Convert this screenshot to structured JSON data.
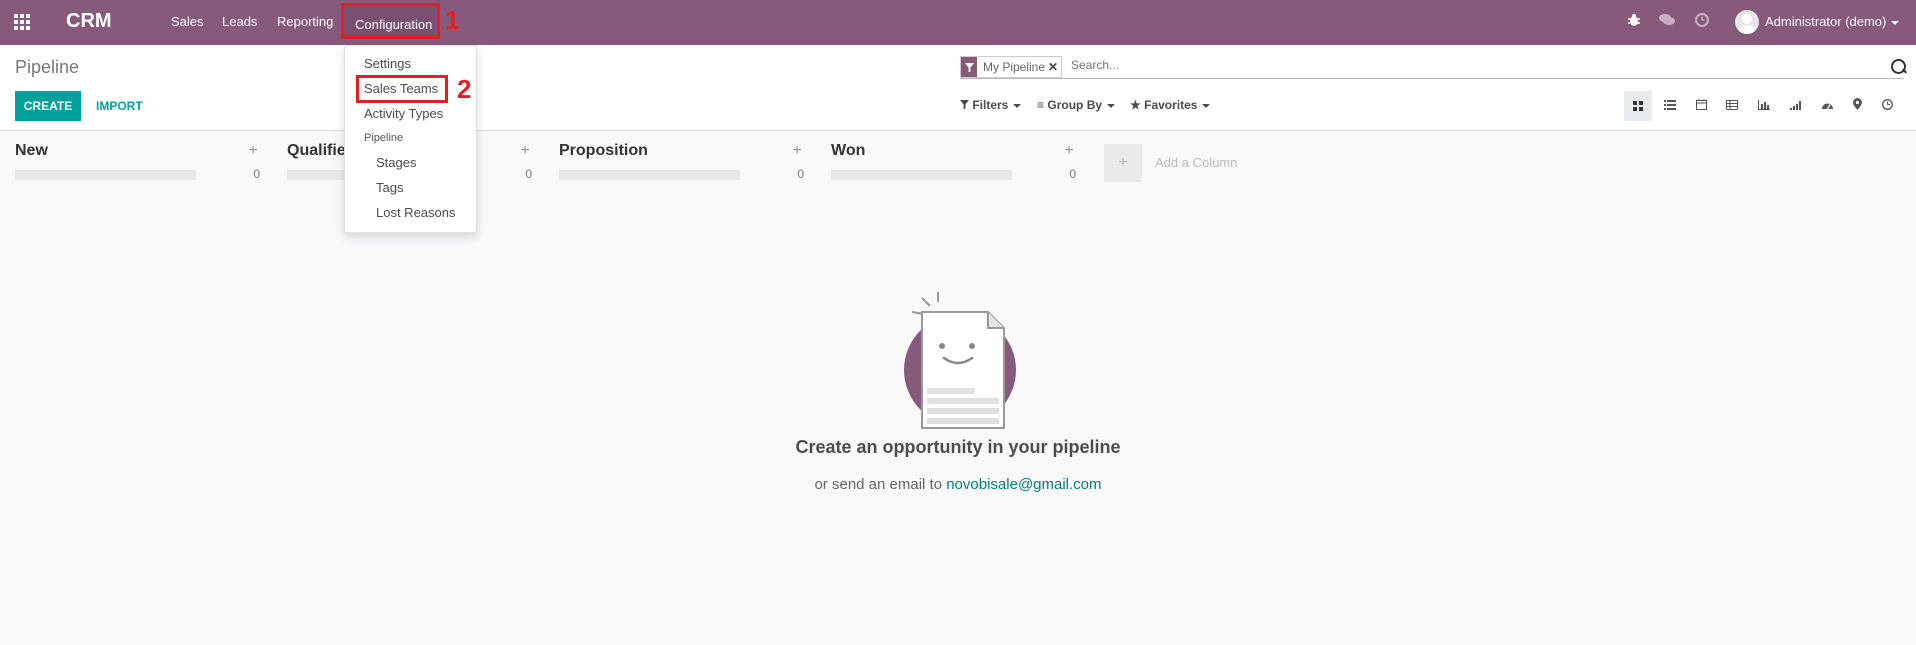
{
  "navbar": {
    "brand": "CRM",
    "menu": [
      "Sales",
      "Leads",
      "Reporting",
      "Configuration"
    ],
    "user": "Administrator (demo)",
    "system_icons": [
      "bug-icon",
      "chat-icon",
      "clock-icon"
    ]
  },
  "annotations": {
    "step1": "1",
    "step2": "2"
  },
  "config_menu": {
    "items": [
      "Settings",
      "Sales Teams",
      "Activity Types"
    ],
    "pipeline_header": "Pipeline",
    "pipeline_items": [
      "Stages",
      "Tags",
      "Lost Reasons"
    ]
  },
  "control_panel": {
    "breadcrumb": "Pipeline",
    "create_label": "CREATE",
    "import_label": "IMPORT",
    "facet": "My Pipeline",
    "search_placeholder": "Search...",
    "filters": "Filters",
    "group_by": "Group By",
    "favorites": "Favorites",
    "views": [
      "kanban",
      "list",
      "calendar",
      "pivot",
      "graph",
      "cohort",
      "dashboard",
      "map",
      "activity"
    ],
    "active_view": "kanban"
  },
  "columns": [
    {
      "title": "New",
      "count": "0"
    },
    {
      "title": "Qualified",
      "count": "0"
    },
    {
      "title": "Proposition",
      "count": "0"
    },
    {
      "title": "Won",
      "count": "0"
    }
  ],
  "add_column": "Add a Column",
  "empty": {
    "title": "Create an opportunity in your pipeline",
    "sub_prefix": "or send an email to",
    "email": "novobisale@gmail.com"
  },
  "colors": {
    "brand": "#875a7b",
    "accent": "#00a09d",
    "annotation": "#e31e24"
  }
}
